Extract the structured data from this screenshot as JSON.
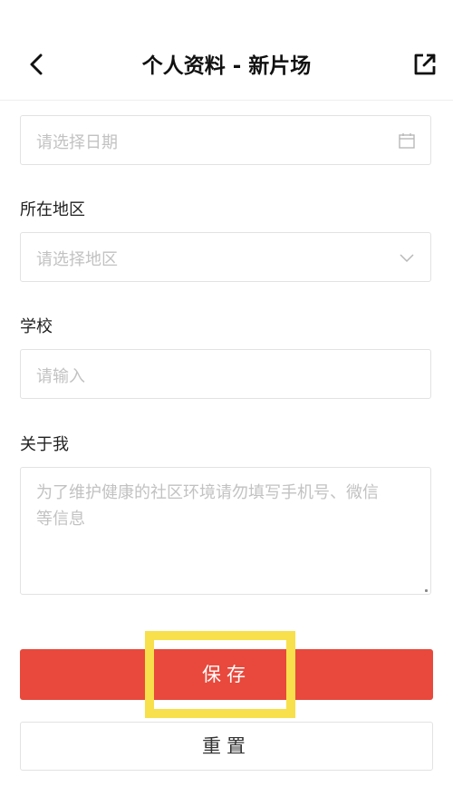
{
  "header": {
    "title": "个人资料 - 新片场",
    "back_icon": "chevron-left-icon",
    "share_icon": "external-link-icon"
  },
  "form": {
    "date_field": {
      "placeholder": "请选择日期",
      "icon": "calendar-icon"
    },
    "region": {
      "label": "所在地区",
      "placeholder": "请选择地区",
      "icon": "chevron-down-icon"
    },
    "school": {
      "label": "学校",
      "placeholder": "请输入"
    },
    "about": {
      "label": "关于我",
      "placeholder_line1": "为了维护健康的社区环境请勿填写手机号、微信",
      "placeholder_line2": "等信息"
    }
  },
  "buttons": {
    "save_label": "保存",
    "reset_label": "重置"
  },
  "colors": {
    "primary": "#e8493c",
    "highlight": "#f7e04b",
    "placeholder": "#c2c2c2",
    "border": "#e2e2e2"
  }
}
